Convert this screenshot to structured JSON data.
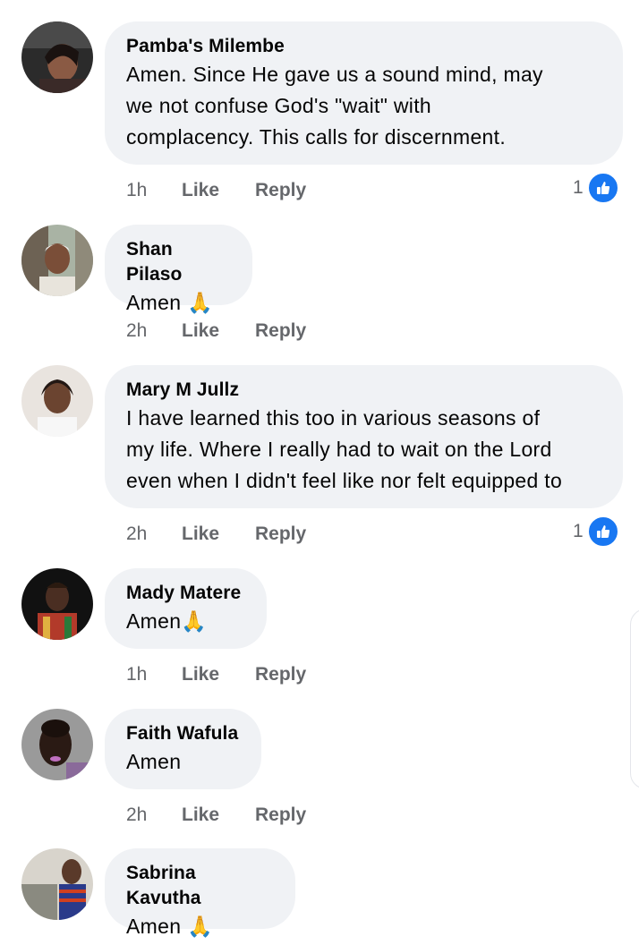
{
  "comments": [
    {
      "author": "Pamba's Milembe",
      "lines": [
        "Amen. Since He gave us a sound mind, may",
        "we not confuse God's \"wait\" with",
        "complacency. This calls for discernment."
      ],
      "time": "1h",
      "like": "Like",
      "reply": "Reply",
      "reactions": "1"
    },
    {
      "author": "Shan Pilaso",
      "lines": [
        "Amen 🙏"
      ],
      "time": "2h",
      "like": "Like",
      "reply": "Reply"
    },
    {
      "author": "Mary M Jullz",
      "lines": [
        "I have learned this too in various seasons of",
        "my life. Where I really had to wait on the Lord",
        "even when I didn't feel like nor felt equipped to"
      ],
      "time": "2h",
      "like": "Like",
      "reply": "Reply",
      "reactions": "1"
    },
    {
      "author": "Mady Matere",
      "lines": [
        "Amen🙏"
      ],
      "time": "1h",
      "like": "Like",
      "reply": "Reply"
    },
    {
      "author": "Faith Wafula",
      "lines": [
        "Amen"
      ],
      "time": "2h",
      "like": "Like",
      "reply": "Reply"
    },
    {
      "author": "Sabrina Kavutha",
      "lines": [
        "Amen 🙏"
      ]
    }
  ],
  "colors": {
    "bubble": "#f0f2f5",
    "meta": "#65676b",
    "like_badge": "#1877f2"
  }
}
